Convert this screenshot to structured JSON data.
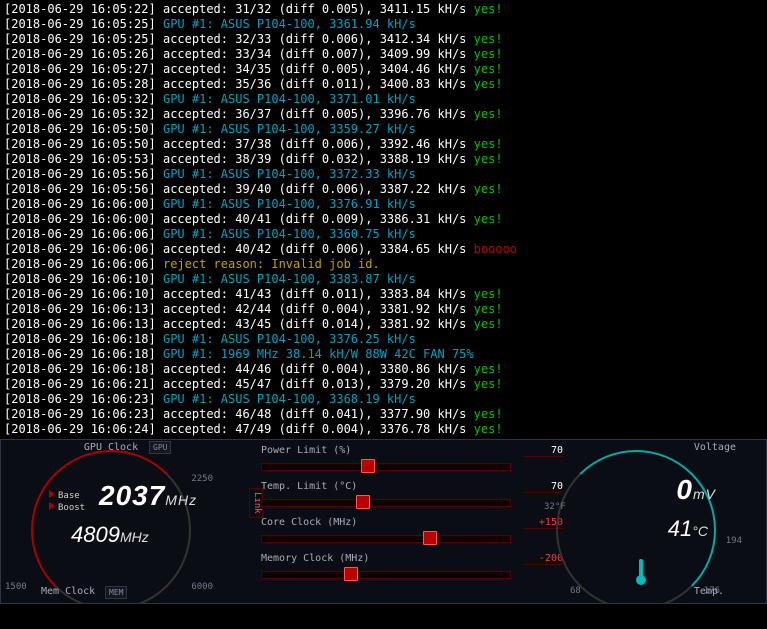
{
  "terminal_lines": [
    {
      "ts": "2018-06-29 16:05:22",
      "type": "accept",
      "msg": "accepted: 31/32 (diff 0.005), 3411.15 kH/s",
      "tag": "yes!"
    },
    {
      "ts": "2018-06-29 16:05:25",
      "type": "gpu",
      "msg": "GPU #1: ASUS P104-100, 3361.94 kH/s"
    },
    {
      "ts": "2018-06-29 16:05:25",
      "type": "accept",
      "msg": "accepted: 32/33 (diff 0.006), 3412.34 kH/s",
      "tag": "yes!"
    },
    {
      "ts": "2018-06-29 16:05:26",
      "type": "accept",
      "msg": "accepted: 33/34 (diff 0.007), 3409.99 kH/s",
      "tag": "yes!"
    },
    {
      "ts": "2018-06-29 16:05:27",
      "type": "accept",
      "msg": "accepted: 34/35 (diff 0.005), 3404.46 kH/s",
      "tag": "yes!"
    },
    {
      "ts": "2018-06-29 16:05:28",
      "type": "accept",
      "msg": "accepted: 35/36 (diff 0.011), 3400.83 kH/s",
      "tag": "yes!"
    },
    {
      "ts": "2018-06-29 16:05:32",
      "type": "gpu",
      "msg": "GPU #1: ASUS P104-100, 3371.01 kH/s"
    },
    {
      "ts": "2018-06-29 16:05:32",
      "type": "accept",
      "msg": "accepted: 36/37 (diff 0.005), 3396.76 kH/s",
      "tag": "yes!"
    },
    {
      "ts": "2018-06-29 16:05:50",
      "type": "gpu",
      "msg": "GPU #1: ASUS P104-100, 3359.27 kH/s"
    },
    {
      "ts": "2018-06-29 16:05:50",
      "type": "accept",
      "msg": "accepted: 37/38 (diff 0.006), 3392.46 kH/s",
      "tag": "yes!"
    },
    {
      "ts": "2018-06-29 16:05:53",
      "type": "accept",
      "msg": "accepted: 38/39 (diff 0.032), 3388.19 kH/s",
      "tag": "yes!"
    },
    {
      "ts": "2018-06-29 16:05:56",
      "type": "gpu",
      "msg": "GPU #1: ASUS P104-100, 3372.33 kH/s"
    },
    {
      "ts": "2018-06-29 16:05:56",
      "type": "accept",
      "msg": "accepted: 39/40 (diff 0.006), 3387.22 kH/s",
      "tag": "yes!"
    },
    {
      "ts": "2018-06-29 16:06:00",
      "type": "gpu",
      "msg": "GPU #1: ASUS P104-100, 3376.91 kH/s"
    },
    {
      "ts": "2018-06-29 16:06:00",
      "type": "accept",
      "msg": "accepted: 40/41 (diff 0.009), 3386.31 kH/s",
      "tag": "yes!"
    },
    {
      "ts": "2018-06-29 16:06:06",
      "type": "gpu",
      "msg": "GPU #1: ASUS P104-100, 3360.75 kH/s"
    },
    {
      "ts": "2018-06-29 16:06:06",
      "type": "accept",
      "msg": "accepted: 40/42 (diff 0.006), 3384.65 kH/s",
      "tag": "booooo"
    },
    {
      "ts": "2018-06-29 16:06:06",
      "type": "reject",
      "msg": "reject reason: Invalid job id."
    },
    {
      "ts": "2018-06-29 16:06:10",
      "type": "gpu",
      "msg": "GPU #1: ASUS P104-100, 3383.87 kH/s"
    },
    {
      "ts": "2018-06-29 16:06:10",
      "type": "accept",
      "msg": "accepted: 41/43 (diff 0.011), 3383.84 kH/s",
      "tag": "yes!"
    },
    {
      "ts": "2018-06-29 16:06:13",
      "type": "accept",
      "msg": "accepted: 42/44 (diff 0.004), 3381.92 kH/s",
      "tag": "yes!"
    },
    {
      "ts": "2018-06-29 16:06:13",
      "type": "accept",
      "msg": "accepted: 43/45 (diff 0.014), 3381.92 kH/s",
      "tag": "yes!"
    },
    {
      "ts": "2018-06-29 16:06:18",
      "type": "gpu",
      "msg": "GPU #1: ASUS P104-100, 3376.25 kH/s"
    },
    {
      "ts": "2018-06-29 16:06:18",
      "type": "gpu",
      "msg": "GPU #1: 1969 MHz 38.14 kH/W 88W 42C FAN 75%"
    },
    {
      "ts": "2018-06-29 16:06:18",
      "type": "accept",
      "msg": "accepted: 44/46 (diff 0.004), 3380.86 kH/s",
      "tag": "yes!"
    },
    {
      "ts": "2018-06-29 16:06:21",
      "type": "accept",
      "msg": "accepted: 45/47 (diff 0.013), 3379.20 kH/s",
      "tag": "yes!"
    },
    {
      "ts": "2018-06-29 16:06:23",
      "type": "gpu",
      "msg": "GPU #1: ASUS P104-100, 3368.19 kH/s"
    },
    {
      "ts": "2018-06-29 16:06:23",
      "type": "accept",
      "msg": "accepted: 46/48 (diff 0.041), 3377.90 kH/s",
      "tag": "yes!"
    },
    {
      "ts": "2018-06-29 16:06:24",
      "type": "accept",
      "msg": "accepted: 47/49 (diff 0.004), 3376.78 kH/s",
      "tag": "yes!"
    }
  ],
  "afterburner": {
    "gpu_clock": {
      "label": "GPU Clock",
      "value": "2037",
      "unit": "MHz",
      "base_label": "Base",
      "boost_label": "Boost",
      "tick_2250": "2250",
      "tick_1500": "1500"
    },
    "mem_clock": {
      "label": "Mem Clock",
      "value": "4809",
      "unit": "MHz",
      "tick_6000": "6000"
    },
    "sliders": {
      "power": {
        "label": "Power Limit (%)",
        "value": "70",
        "pct": 40
      },
      "temp": {
        "label": "Temp. Limit (°C)",
        "value": "70",
        "pct": 38
      },
      "core": {
        "label": "Core Clock (MHz)",
        "value": "+150",
        "pct": 65,
        "red": true
      },
      "memory": {
        "label": "Memory Clock (MHz)",
        "value": "-200",
        "pct": 33,
        "red": true
      }
    },
    "voltage": {
      "label": "Voltage",
      "value": "0",
      "unit": "mV"
    },
    "temp_gauge": {
      "label": "Temp.",
      "value": "41",
      "unit": "°C",
      "tick_32": "32°F",
      "tick_68": "68",
      "tick_194": "194",
      "tick_176": "176"
    },
    "link_label": "Link",
    "chip_gpu": "GPU",
    "chip_mem": "MEM"
  }
}
